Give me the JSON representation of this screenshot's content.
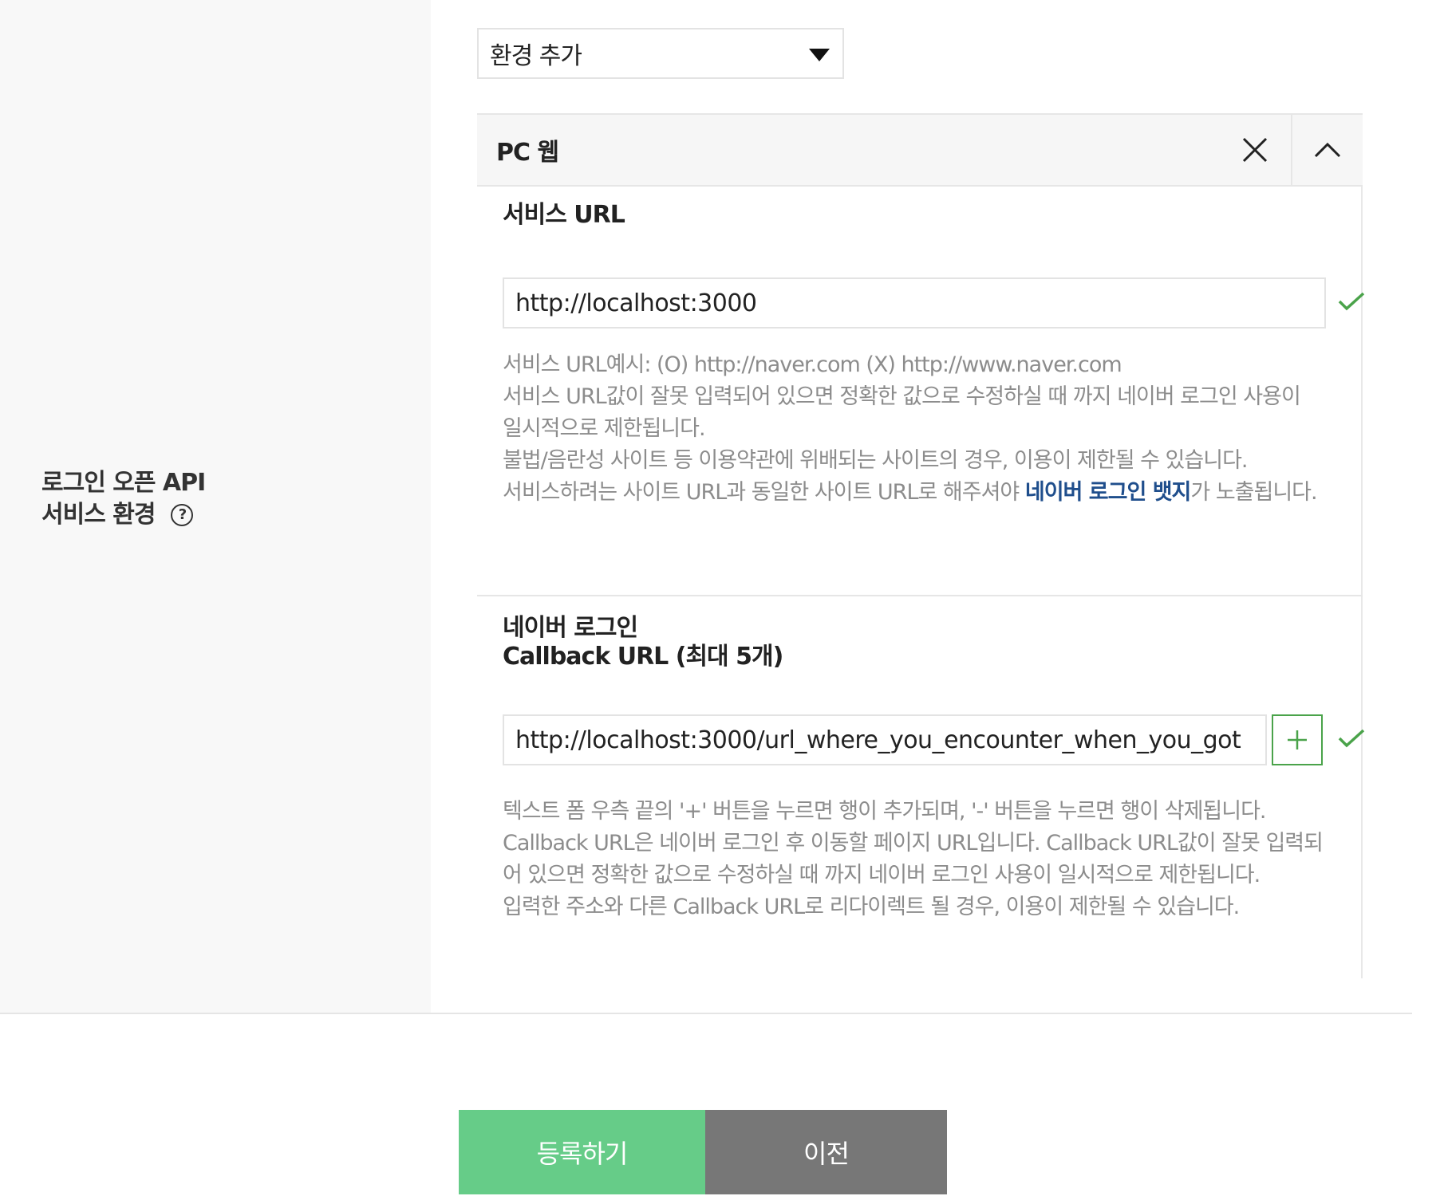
{
  "form_row": {
    "label_line1": "로그인 오픈 API",
    "label_line2": "서비스 환경",
    "help_icon_char": "?"
  },
  "env_select": {
    "selected": "환경 추가"
  },
  "pc_web_panel": {
    "title": "PC 웹",
    "service_url": {
      "title": "서비스 URL",
      "value": "http://localhost:3000",
      "help_1": "서비스 URL예시: (O) http://naver.com (X) http://www.naver.com",
      "help_2": "서비스 URL값이 잘못 입력되어 있으면 정확한 값으로 수정하실 때 까지 네이버 로그인 사용이 일시적으로 제한됩니다.",
      "help_3": "불법/음란성 사이트 등 이용약관에 위배되는 사이트의 경우, 이용이 제한될 수 있습니다.",
      "help_4_before": "서비스하려는 사이트 URL과 동일한 사이트 URL로 해주셔야 ",
      "help_4_link": "네이버 로그인 뱃지",
      "help_4_after": "가 노출됩니다."
    },
    "callback_url": {
      "title_line1": "네이버 로그인",
      "title_line2": "Callback URL (최대 5개)",
      "value": "http://localhost:3000/url_where_you_encounter_when_you_got",
      "add_button_symbol": "+",
      "help_1": "텍스트 폼 우측 끝의 '+' 버튼을 누르면 행이 추가되며, '-' 버튼을 누르면 행이 삭제됩니다.",
      "help_2": "Callback URL은 네이버 로그인 후 이동할 페이지 URL입니다. Callback URL값이 잘못 입력되어 있으면 정확한 값으로 수정하실 때 까지 네이버 로그인 사용이 일시적으로 제한됩니다.",
      "help_3": "입력한 주소와 다른 Callback URL로 리다이렉트 될 경우, 이용이 제한될 수 있습니다."
    }
  },
  "buttons": {
    "register": "등록하기",
    "previous": "이전"
  },
  "colors": {
    "register_bg": "#66cc88",
    "previous_bg": "#777777",
    "check_green": "#4aa34a",
    "link_blue": "#1f4e8c"
  },
  "icons": [
    "help-icon",
    "dropdown-caret-icon",
    "close-icon",
    "chevron-up-icon",
    "check-icon",
    "plus-icon"
  ]
}
